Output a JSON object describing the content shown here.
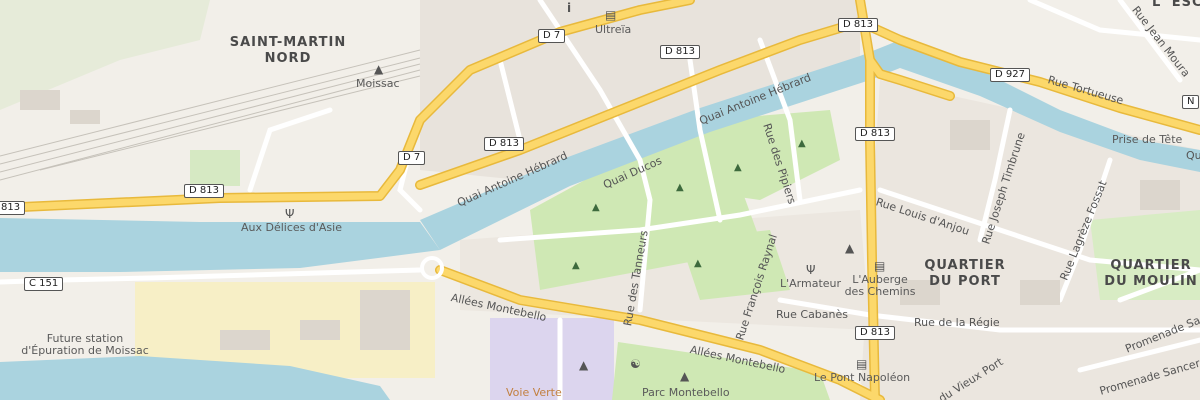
{
  "colors": {
    "water": "#aad3df",
    "land": "#f2efe9",
    "park": "#cfe8b4",
    "road_major": "#fcd86b",
    "road_minor": "#ffffff",
    "railway": "#c8c4bd",
    "sand": "#f7efc6",
    "school": "#dcd5ee",
    "label": "#555555"
  },
  "districts": [
    {
      "line1": "SAINT-MARTIN",
      "line2": "NORD"
    },
    {
      "line1": "QUARTIER",
      "line2": "DU PORT"
    },
    {
      "line1": "QUARTIER",
      "line2": "DU MOULIN"
    },
    {
      "line1": "L' ESC",
      "line2": ""
    }
  ],
  "roads": {
    "shields": [
      "D 7",
      "D 813",
      "D 7",
      "D 813",
      "D 813",
      "D 813",
      "D 927",
      "D 813",
      "C 151",
      "D 813"
    ],
    "streets": [
      "Quai Antoine Hébrard",
      "Quai Antoine Hébrard",
      "Quai Ducos",
      "Rue des Pipiers",
      "Rue des Tanneurs",
      "Rue François Raynal",
      "Rue Louis d'Anjou",
      "Rue Joseph Timbrune",
      "Rue Lagrèze Fossat",
      "Rue Cabanès",
      "Rue de la Régie",
      "Allées Montebello",
      "Allées Montebello",
      "Rue Tortueuse",
      "Rue Jean Moura",
      "Promenade Sancer",
      "Promenade Sa",
      "du Vieux Port",
      "Voie Verte",
      "Qu"
    ]
  },
  "places": {
    "ultreia": "Ultreïa",
    "moissac": "Moissac",
    "delices": "Aux Délices d'Asie",
    "armateur": "L'Armateur",
    "auberge_l1": "L'Auberge",
    "auberge_l2": "des Chemins",
    "pont": "Le Pont Napoléon",
    "prise": "Prise de Tête",
    "parc": "Parc Montebello",
    "station_l1": "Future station",
    "station_l2": "d'Épuration de Moissac"
  },
  "icons": [
    "info-icon",
    "hotel-icon",
    "train-station-icon",
    "restaurant-icon",
    "restaurant-icon",
    "museum-icon",
    "hotel-icon",
    "hotel-icon",
    "school-icon",
    "playground-icon",
    "tree-icon",
    "park-icon"
  ]
}
